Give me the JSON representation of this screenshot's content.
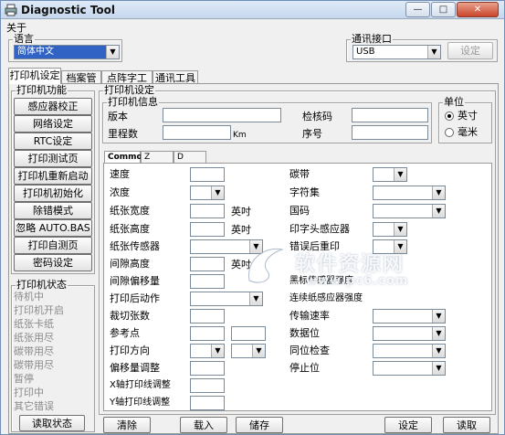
{
  "window": {
    "title": "Diagnostic Tool",
    "min": "—",
    "max": "□",
    "close": "✕"
  },
  "menu": {
    "about": "关于"
  },
  "language": {
    "group": "语言",
    "value": "简体中文"
  },
  "comm": {
    "group": "通讯接口",
    "value": "USB",
    "setting": "设定"
  },
  "tabs": [
    "打印机设定",
    "档案管理",
    "点阵字工具",
    "通讯工具"
  ],
  "functions": {
    "group": "打印机功能",
    "buttons": [
      "感应器校正",
      "网络设定",
      "RTC设定",
      "打印测试页",
      "打印机重新启动",
      "打印机初始化",
      "除错模式",
      "忽略 AUTO.BAS",
      "打印自测页",
      "密码设定"
    ]
  },
  "status": {
    "group": "打印机状态",
    "items": [
      "待机中",
      "打印机开启",
      "纸张卡纸",
      "纸张用尽",
      "碳带用尽",
      "碳带用尽",
      "暂停",
      "打印中",
      "其它错误"
    ],
    "read": "读取状态"
  },
  "settings": {
    "group": "打印机设定",
    "info_group": "打印机信息",
    "version": "版本",
    "checksum": "检核码",
    "mileage": "里程数",
    "km": "Km",
    "serial": "序号",
    "unit_group": "单位",
    "unit_inch": "英寸",
    "unit_mm": "毫米"
  },
  "inner_tabs": [
    "Common",
    "Z",
    "D"
  ],
  "common_left": {
    "speed": "速度",
    "density": "浓度",
    "width": "纸张宽度",
    "width_unit": "英吋",
    "height": "纸张高度",
    "height_unit": "英吋",
    "sensor": "纸张传感器",
    "gap": "间隙高度",
    "gap_unit": "英吋",
    "gap_offset": "间隙偏移量",
    "post_action": "打印后动作",
    "cut_count": "裁切张数",
    "ref_point": "参考点",
    "direction": "打印方向",
    "offset": "偏移量调整",
    "x_adj": "X轴打印线调整",
    "y_adj": "Y轴打印线调整"
  },
  "common_right": {
    "ribbon": "碳带",
    "charset": "字符集",
    "code_page": "国码",
    "head_sensor": "印字头感应器",
    "error_reprint": "错误后重印",
    "gap_sensor_light": "黑标传感器强度",
    "continuous_sensor": "连续纸感应器强度",
    "baud": "传输速率",
    "data_bits": "数据位",
    "parity": "同位检查",
    "stop_bits": "停止位"
  },
  "bottom": {
    "clear": "清除",
    "load": "载入",
    "save": "储存",
    "set": "设定",
    "read": "读取"
  },
  "watermark": {
    "brand": "软件资源网",
    "url": "www.pc6.com"
  },
  "icons": {
    "app": "printer-icon",
    "combo": "chevron-down-icon",
    "radio": "radio-icon"
  }
}
